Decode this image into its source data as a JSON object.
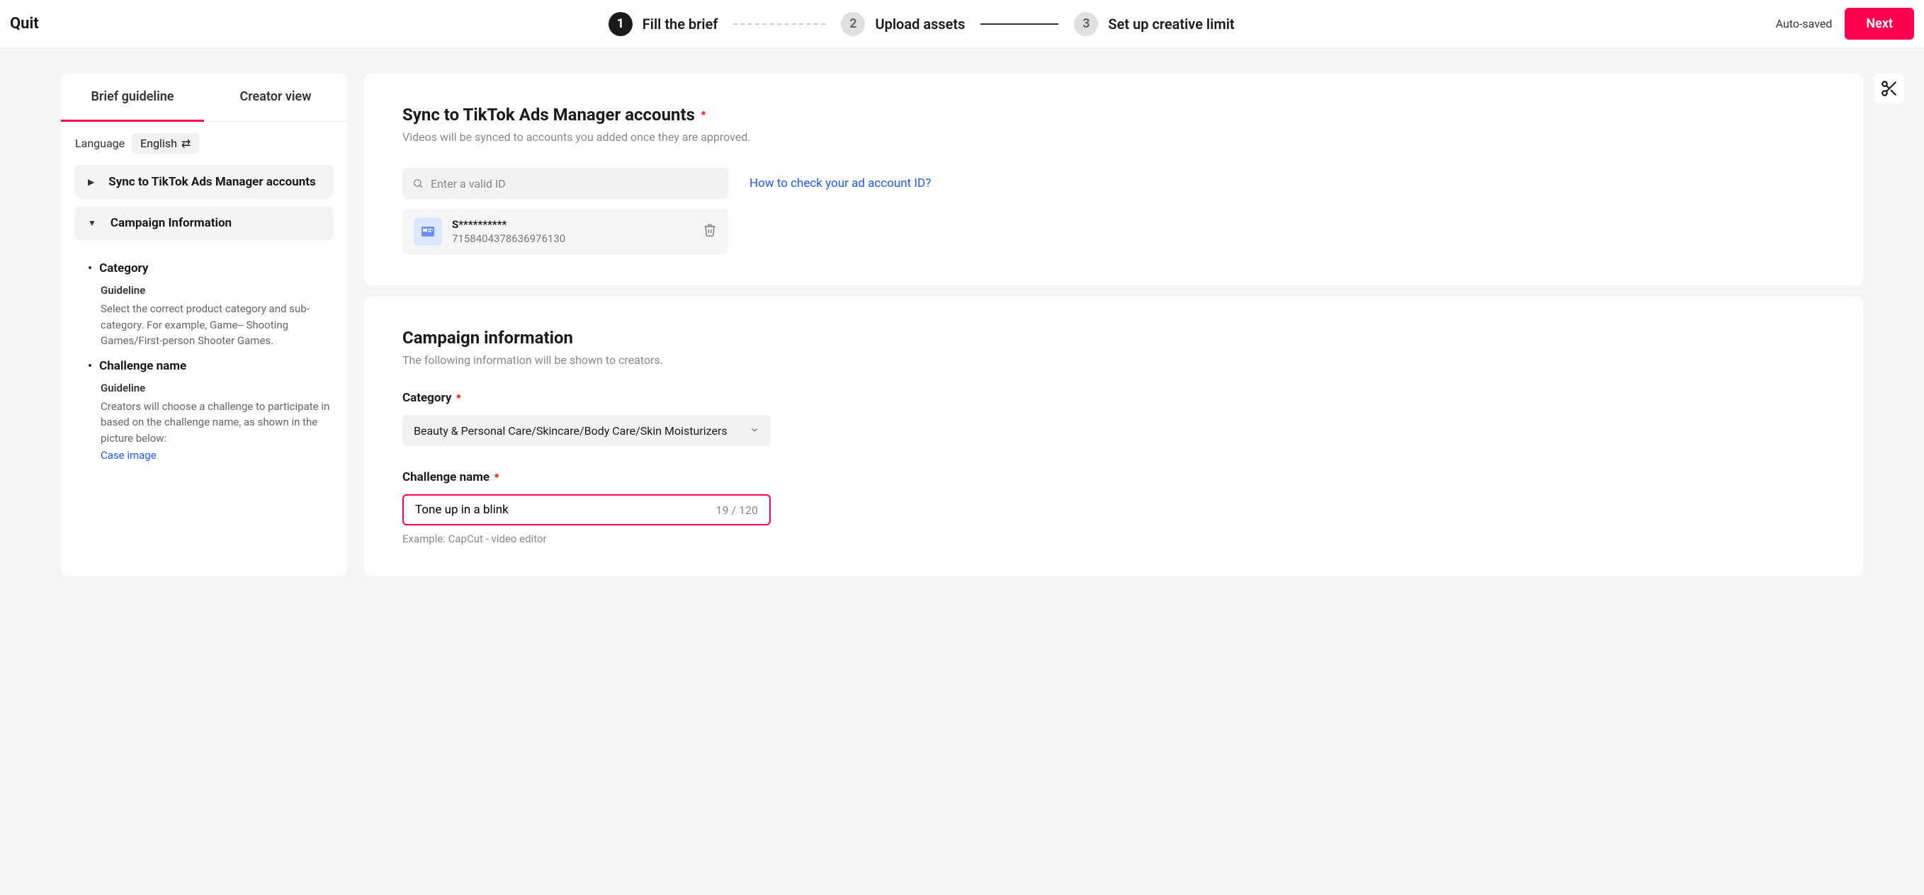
{
  "header": {
    "quit": "Quit",
    "steps": [
      {
        "num": "1",
        "label": "Fill the brief",
        "active": true
      },
      {
        "num": "2",
        "label": "Upload assets",
        "active": false
      },
      {
        "num": "3",
        "label": "Set up creative limit",
        "active": false
      }
    ],
    "auto_saved": "Auto-saved",
    "next": "Next"
  },
  "sidebar": {
    "tabs": {
      "guideline": "Brief guideline",
      "creator": "Creator view"
    },
    "language_label": "Language",
    "language_value": "English",
    "nav": {
      "sync": "Sync to TikTok Ads Manager accounts",
      "campaign": "Campaign Information"
    },
    "guide": {
      "category_title": "Category",
      "guideline_label": "Guideline",
      "category_body": "Select the correct product category and sub-category. For example, Game-- Shooting Games/First-person Shooter Games.",
      "challenge_title": "Challenge name",
      "challenge_body": "Creators will choose a challenge to participate in based on the challenge name, as shown in the picture below:",
      "case_link": "Case image"
    }
  },
  "sync": {
    "title": "Sync to TikTok Ads Manager accounts",
    "subtitle": "Videos will be synced to accounts you added once they are approved.",
    "search_placeholder": "Enter a valid ID",
    "help_link": "How to check your ad account ID?",
    "account": {
      "name": "S**********",
      "id": "7158404378636976130"
    }
  },
  "campaign": {
    "title": "Campaign information",
    "subtitle": "The following information will be shown to creators.",
    "category_label": "Category",
    "category_value": "Beauty & Personal Care/Skincare/Body Care/Skin Moisturizers",
    "challenge_label": "Challenge name",
    "challenge_value": "Tone up in a blink",
    "char_count": "19 / 120",
    "example": "Example: CapCut - video editor"
  }
}
